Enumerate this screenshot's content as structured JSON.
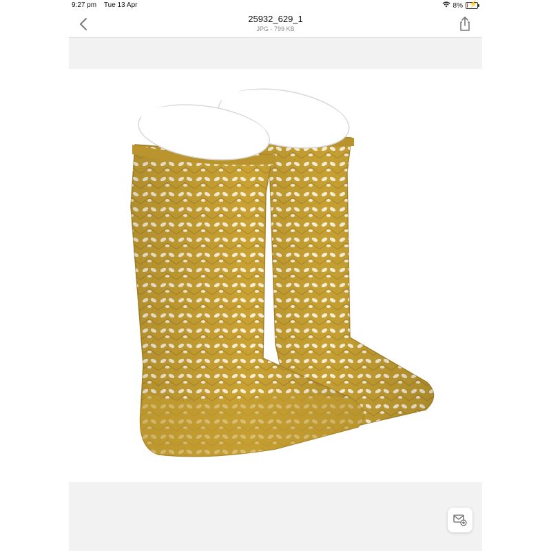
{
  "status_bar": {
    "time": "9:27 pm",
    "date": "Tue 13 Apr",
    "battery_percent": "8%",
    "battery_level": 0.08,
    "battery_color": "#e0302a",
    "wifi_icon": "wifi-icon",
    "charging_icon": "charging-bolt-icon"
  },
  "nav": {
    "title": "25932_629_1",
    "subtitle": "JPG - 799 KB",
    "back_icon": "chevron-left-icon",
    "share_icon": "share-icon"
  },
  "image": {
    "subject": "mustard openwork knee-high socks on white mannequin legs",
    "sock_color": "#c9a233"
  },
  "actions": {
    "markup_icon": "mail-compose-icon"
  }
}
